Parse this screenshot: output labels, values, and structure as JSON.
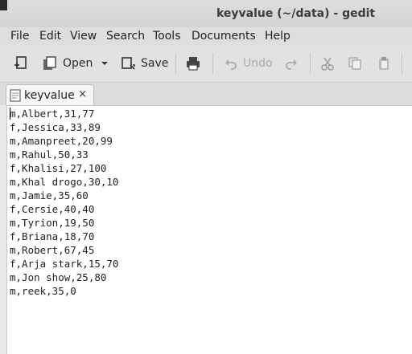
{
  "window": {
    "title": "keyvalue (~/data) - gedit"
  },
  "menu": [
    "File",
    "Edit",
    "View",
    "Search",
    "Tools",
    "Documents",
    "Help"
  ],
  "toolbar": {
    "open_label": "Open",
    "save_label": "Save",
    "undo_label": "Undo"
  },
  "tab": {
    "label": "keyvalue",
    "close": "×"
  },
  "editor": {
    "lines": [
      "m,Albert,31,77",
      "f,Jessica,33,89",
      "m,Amanpreet,20,99",
      "m,Rahul,50,33",
      "f,Khalisi,27,100",
      "m,Khal drogo,30,10",
      "m,Jamie,35,60",
      "f,Cersie,40,40",
      "m,Tyrion,19,50",
      "f,Briana,18,70",
      "m,Robert,67,45",
      "f,Arja stark,15,70",
      "m,Jon show,25,80",
      "m,reek,35,0"
    ]
  }
}
